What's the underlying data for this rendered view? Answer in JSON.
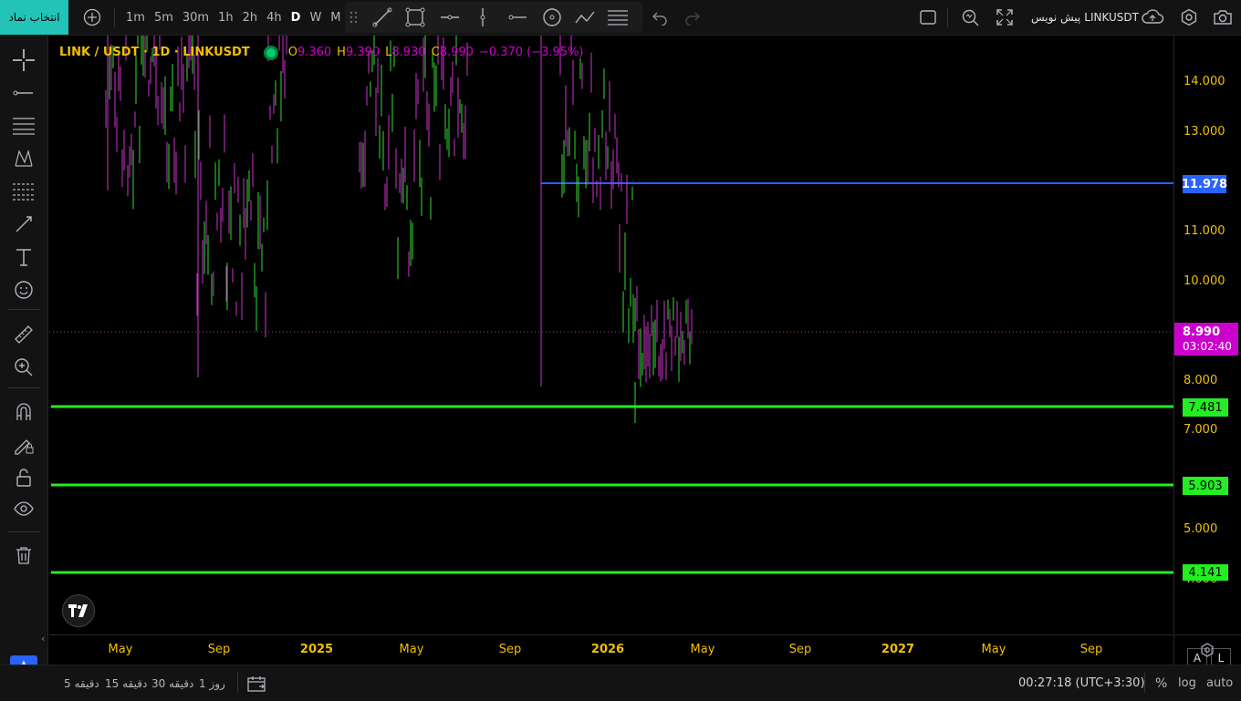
{
  "topbar": {
    "symbol_search_button": "انتخاب نماد",
    "timeframes": [
      "1m",
      "5m",
      "30m",
      "1h",
      "2h",
      "4h",
      "D",
      "W",
      "M"
    ],
    "active_timeframe": "D",
    "symbol_name": "LINKUSDT",
    "symbol_label": "پیش نویس"
  },
  "legend": {
    "title": "LINK / USDT · 1D · LINKUSDT",
    "open_label": "O",
    "open": "9.360",
    "high_label": "H",
    "high": "9.390",
    "low_label": "L",
    "low": "8.930",
    "close_label": "C",
    "close": "8.990",
    "change": "−0.370 (−3.95%)"
  },
  "yaxis": {
    "ticks": [
      "14.000",
      "13.000",
      "11.000",
      "10.000",
      "8.000",
      "7.000",
      "5.000",
      "4.000"
    ],
    "badges": {
      "blue_line": "11.978",
      "last_price": "8.990",
      "countdown": "03:02:40",
      "green_1": "7.481",
      "green_2": "5.903",
      "green_3": "4.141"
    },
    "scale_buttons": [
      "A",
      "L"
    ]
  },
  "xaxis": {
    "ticks": [
      {
        "label": "May",
        "year": false
      },
      {
        "label": "Sep",
        "year": false
      },
      {
        "label": "2025",
        "year": true
      },
      {
        "label": "May",
        "year": false
      },
      {
        "label": "Sep",
        "year": false
      },
      {
        "label": "2026",
        "year": true
      },
      {
        "label": "May",
        "year": false
      },
      {
        "label": "Sep",
        "year": false
      },
      {
        "label": "2027",
        "year": true
      },
      {
        "label": "May",
        "year": false
      },
      {
        "label": "Sep",
        "year": false
      }
    ]
  },
  "bottombar": {
    "ranges": [
      "دقیقه 5",
      "دقیقه 15",
      "دقیقه 30",
      "روز 1"
    ],
    "clock": "00:27:18 (UTC+3:30)",
    "percent": "%",
    "log": "log",
    "auto": "auto"
  },
  "colors": {
    "up": "#33dd33",
    "down": "#cc33cc",
    "axis_text": "#f0c000",
    "blue_line": "#2962ff",
    "green_line": "#22ee22",
    "last_price": "#cc00cc",
    "accent": "#22c4b8"
  },
  "chart_data": {
    "type": "candlestick",
    "timeframe": "1D",
    "ohlc_last": {
      "open": 9.36,
      "high": 9.39,
      "low": 8.93,
      "close": 8.99
    },
    "horizontal_lines": [
      11.978,
      7.481,
      5.903,
      4.141
    ],
    "last_price": 8.99,
    "y_ticks": [
      14,
      13,
      11,
      10,
      8,
      7,
      5,
      4
    ]
  }
}
